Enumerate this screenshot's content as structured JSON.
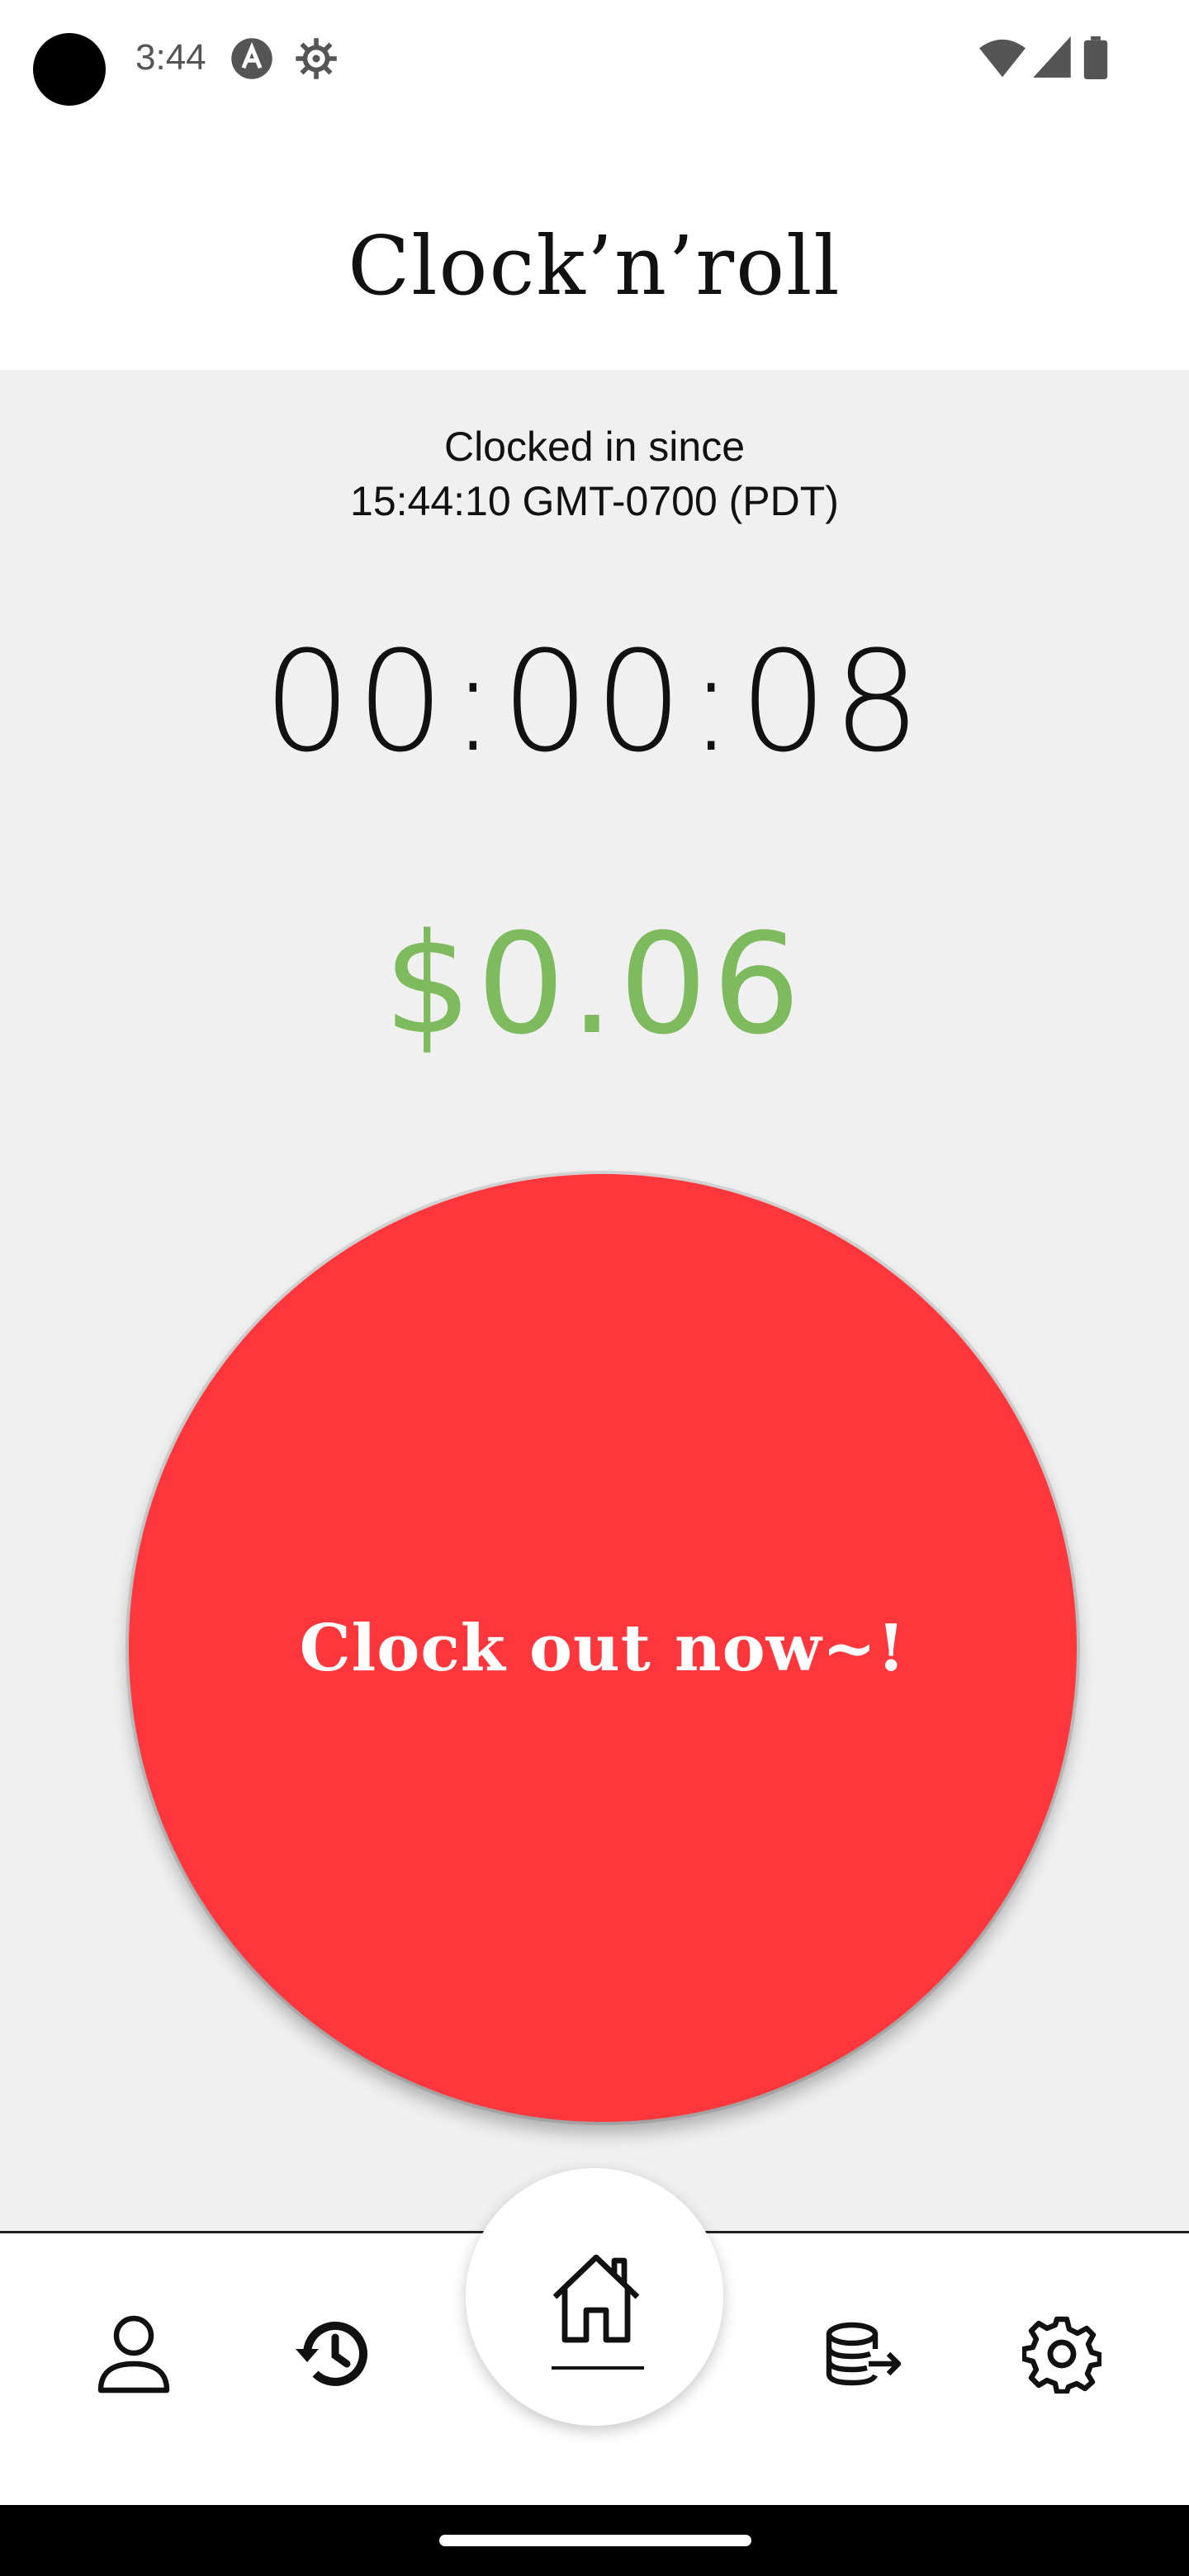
{
  "status_bar": {
    "time": "3:44",
    "icons": [
      "camera-dot",
      "a-badge-icon",
      "gear-icon",
      "wifi-icon",
      "signal-icon",
      "battery-icon"
    ]
  },
  "app": {
    "title": "Clock’n’roll"
  },
  "session": {
    "since_label": "Clocked in since",
    "since_time": "15:44:10 GMT-0700 (PDT)",
    "elapsed": "00:00:08",
    "earnings": "$0.06"
  },
  "clock_button": {
    "label": "Clock out now~!"
  },
  "nav": {
    "items": [
      "profile-icon",
      "history-icon",
      "home-icon",
      "export-data-icon",
      "settings-icon"
    ],
    "active": "home-icon"
  },
  "colors": {
    "earnings": "#7ebb5e",
    "clock_button": "#ff363b",
    "background": "#f0f0f0"
  }
}
